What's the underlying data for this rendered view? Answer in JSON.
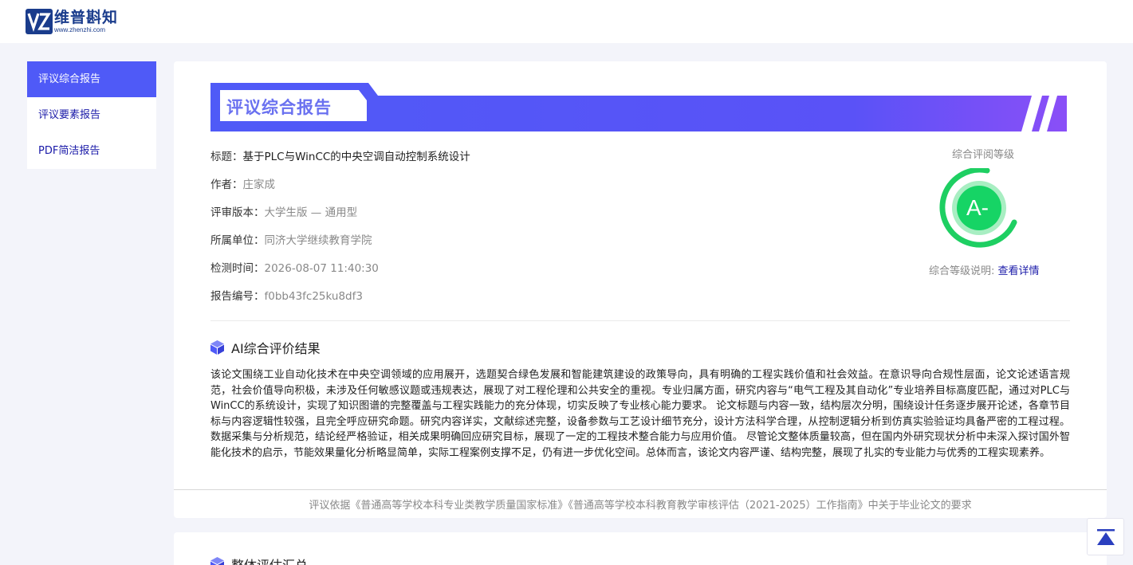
{
  "brand": {
    "name_cn": "维普斟知",
    "name_en": "www.zhenzhi.com"
  },
  "sidebar": {
    "items": [
      {
        "label": "评议综合报告"
      },
      {
        "label": "评议要素报告"
      },
      {
        "label": "PDF简洁报告"
      }
    ]
  },
  "report": {
    "banner_title": "评议综合报告",
    "title_label": "标题：",
    "title_value": "基于PLC与WinCC的中央空调自动控制系统设计",
    "author_label": "作者：",
    "author_value": "庄家成",
    "version_label": "评审版本：",
    "version_value": "大学生版 — 通用型",
    "unit_label": "所属单位：",
    "unit_value": "同济大学继续教育学院",
    "time_label": "检测时间：",
    "time_value": "2026-08-07 11:40:30",
    "id_label": "报告编号：",
    "id_value": "f0bb43fc25ku8df3"
  },
  "grade": {
    "label": "综合评阅等级",
    "value": "A-",
    "note_label": "综合等级说明: ",
    "note_link": "查看详情"
  },
  "ai_section": {
    "title": "AI综合评价结果",
    "text": "该论文围绕工业自动化技术在中央空调领域的应用展开，选题契合绿色发展和智能建筑建设的政策导向，具有明确的工程实践价值和社会效益。在意识导向合规性层面，论文论述语言规范，社会价值导向积极，未涉及任何敏感议题或违规表达，展现了对工程伦理和公共安全的重视。专业归属方面，研究内容与“电气工程及其自动化”专业培养目标高度匹配，通过对PLC与WinCC的系统设计，实现了知识图谱的完整覆盖与工程实践能力的充分体现，切实反映了专业核心能力要求。 论文标题与内容一致，结构层次分明，围绕设计任务逐步展开论述，各章节目标与内容逻辑性较强，且完全呼应研究命题。研究内容详实，文献综述完整，设备参数与工艺设计细节充分，设计方法科学合理，从控制逻辑分析到仿真实验验证均具备严密的工程过程。数据采集与分析规范，结论经严格验证，相关成果明确回应研究目标，展现了一定的工程技术整合能力与应用价值。 尽管论文整体质量较高，但在国内外研究现状分析中未深入探讨国外智能化技术的启示，节能效果量化分析略显简单，实际工程案例支撑不足，仍有进一步优化空间。总体而言，该论文内容严谨、结构完整，展现了扎实的专业能力与优秀的工程实现素养。"
  },
  "footer_note": "评议依据《普通高等学校本科专业类教学质量国家标准》《普通高等学校本科教育教学审核评估（2021-2025）工作指南》中关于毕业论文的要求",
  "summary_section": {
    "title": "整体评估汇总"
  },
  "colors": {
    "accent": "#4f5af7",
    "banner_end": "#8a4ff7",
    "grade_green": "#1ecf62",
    "link": "#1a1aa8"
  }
}
